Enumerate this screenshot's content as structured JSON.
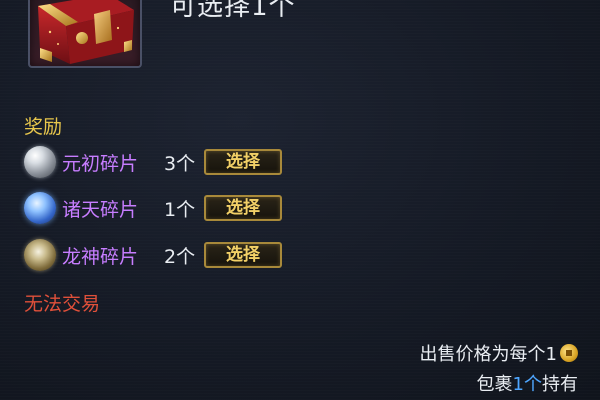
{
  "header": {
    "text": "可选择1个"
  },
  "item": {
    "icon": "treasure-chest-icon"
  },
  "rewards": {
    "title": "奖励",
    "items": [
      {
        "name": "元初碎片",
        "qty": "3个",
        "button": "选择",
        "icon": "silver-orb-icon"
      },
      {
        "name": "诸天碎片",
        "qty": "1个",
        "button": "选择",
        "icon": "blue-crystal-orb-icon"
      },
      {
        "name": "龙神碎片",
        "qty": "2个",
        "button": "选择",
        "icon": "gold-dragon-orb-icon"
      }
    ]
  },
  "restriction": "无法交易",
  "sell": {
    "text": "出售价格为每个1",
    "icon": "coin-icon"
  },
  "bag": {
    "prefix": "包裹",
    "count": "1个",
    "suffix": "持有"
  },
  "colors": {
    "background": "#151a25",
    "title_gold": "#e7c64c",
    "item_purple": "#c77dff",
    "warning_red": "#e0503a",
    "count_blue": "#4ea6ff",
    "button_border": "#a8893a"
  }
}
